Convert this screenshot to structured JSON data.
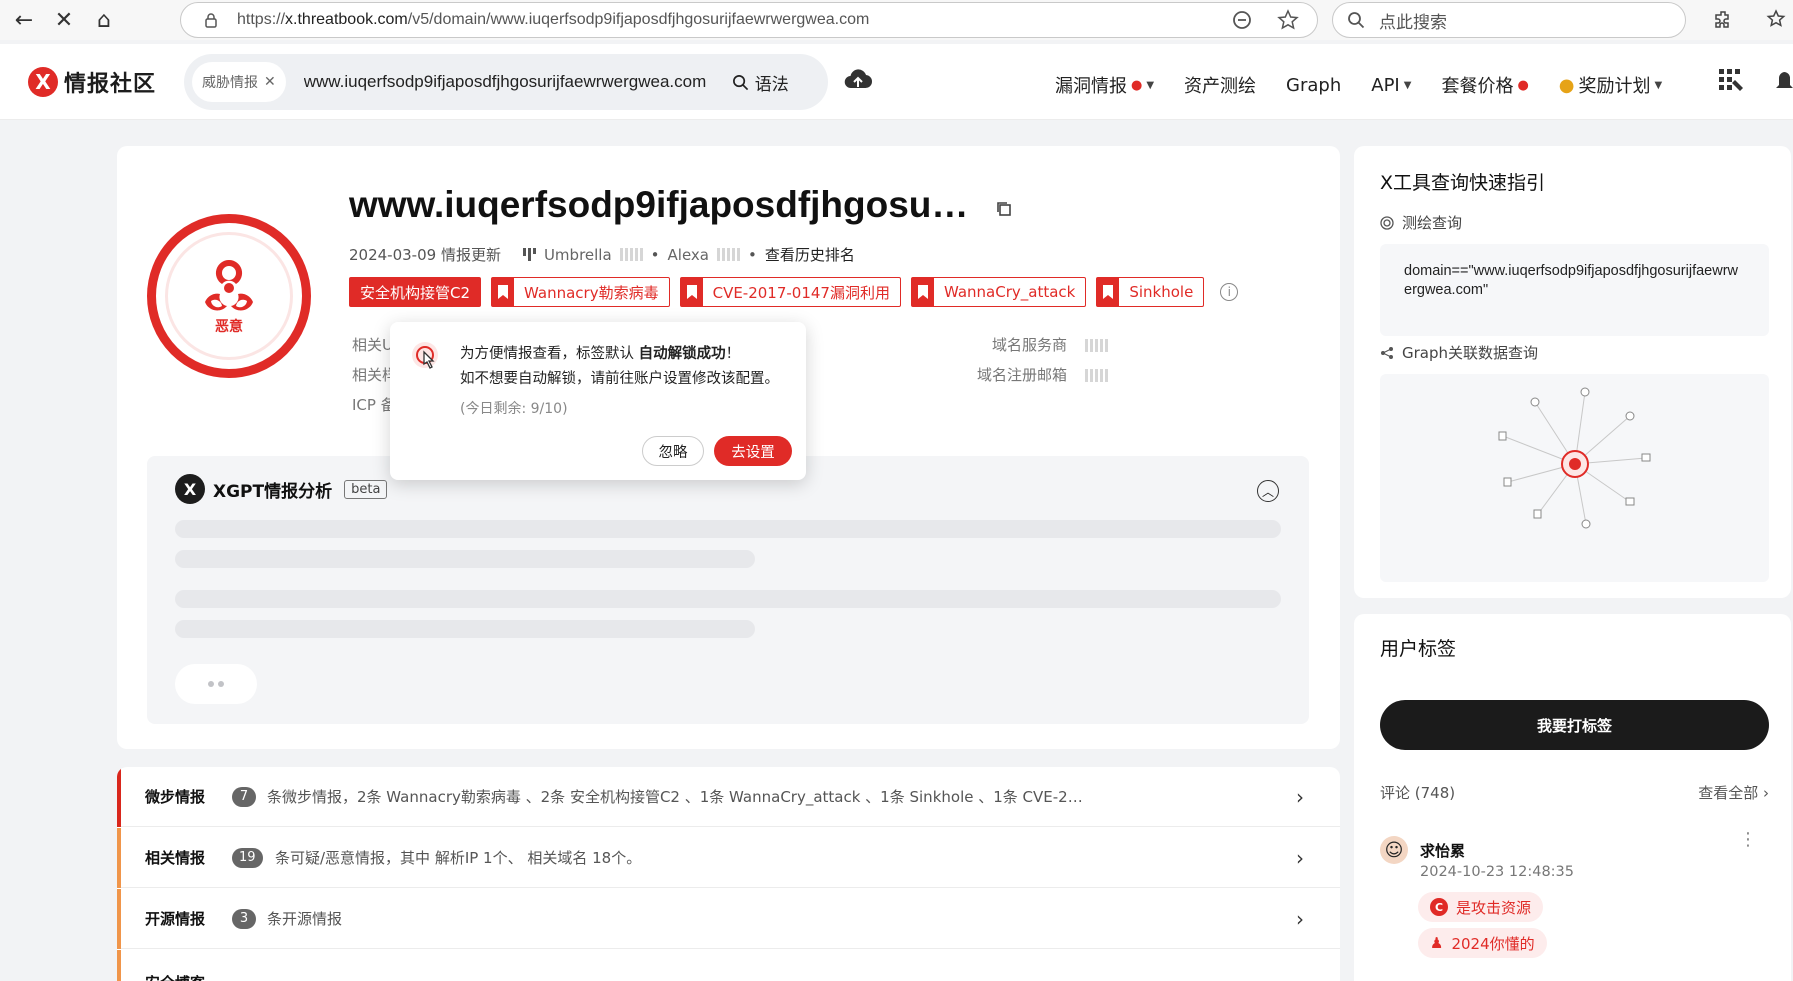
{
  "browser": {
    "url_prefix": "https://",
    "url_host": "x.threatbook.com",
    "url_path": "/v5/domain/www.iuqerfsodp9ifjaposdfjhgosurijfaewrwergwea.com",
    "search_placeholder": "点此搜索"
  },
  "header": {
    "logo_text": "情报社区",
    "search_chip": "威胁情报",
    "search_value": "www.iuqerfsodp9ifjaposdfjhgosurijfaewrwergwea.com",
    "syntax_label": "语法",
    "nav": [
      {
        "label": "漏洞情报",
        "fire": true,
        "caret": true
      },
      {
        "label": "资产测绘",
        "fire": false,
        "caret": false
      },
      {
        "label": "Graph",
        "fire": false,
        "caret": false
      },
      {
        "label": "API",
        "fire": false,
        "caret": true
      },
      {
        "label": "套餐价格",
        "fire": true,
        "caret": false
      },
      {
        "label": "奖励计划",
        "fire": false,
        "caret": true
      }
    ]
  },
  "domain": {
    "title": "www.iuqerfsodp9ifjaposdfjhgosu…",
    "verdict": "恶意",
    "updated": "2024-03-09 情报更新",
    "umbrella": "Umbrella",
    "alexa": "Alexa",
    "history_rank": "查看历史排名",
    "tags": [
      {
        "label": "安全机构接管C2",
        "solid": true
      },
      {
        "label": "Wannacry勒索病毒",
        "solid": false
      },
      {
        "label": "CVE-2017-0147漏洞利用",
        "solid": false
      },
      {
        "label": "WannaCry_attack",
        "solid": false
      },
      {
        "label": "Sinkhole",
        "solid": false
      }
    ],
    "info_left": [
      "相关U",
      "相关样",
      "ICP 备"
    ],
    "info_right": [
      "域名服务商",
      "域名注册邮箱"
    ]
  },
  "popup": {
    "line1_prefix": "为方便情报查看，标签默认 ",
    "line1_bold": "自动解锁成功",
    "line1_suffix": "！",
    "line2": "如不想要自动解锁，请前往账户设置修改该配置。",
    "remaining": "(今日剩余: 9/10)",
    "ignore": "忽略",
    "go": "去设置"
  },
  "xgpt": {
    "title": "XGPT情报分析",
    "badge": "beta"
  },
  "intel": [
    {
      "title": "微步情报",
      "count": "7",
      "desc": "条微步情报，2条 Wannacry勒索病毒 、2条 安全机构接管C2 、1条 WannaCry_attack 、1条 Sinkhole 、1条 CVE-2…",
      "color": "#d9261c"
    },
    {
      "title": "相关情报",
      "count": "19",
      "desc": "条可疑/恶意情报，其中 解析IP 1个、 相关域名 18个。",
      "color": "#f0954a"
    },
    {
      "title": "开源情报",
      "count": "3",
      "desc": "条开源情报",
      "color": "#f0954a"
    },
    {
      "title": "安全博客",
      "count": "",
      "desc": "",
      "color": "#f0954a"
    }
  ],
  "quick_guide": {
    "title": "X工具查询快速指引",
    "mapping_label": "测绘查询",
    "mapping_query": "domain==\"www.iuqerfsodp9ifjaposdfjhgosurijfaewrwergwea.com\"",
    "graph_label": "Graph关联数据查询"
  },
  "user_tags": {
    "title": "用户标签",
    "button": "我要打标签",
    "comments": "评论 (748)",
    "view_all": "查看全部",
    "comment": {
      "name": "求怡累",
      "time": "2024-10-23 12:48:35",
      "tags": [
        "是攻击资源",
        "2024你懂的"
      ]
    }
  },
  "colors": {
    "accent": "#e02b27",
    "dark": "#1b1b1b"
  }
}
